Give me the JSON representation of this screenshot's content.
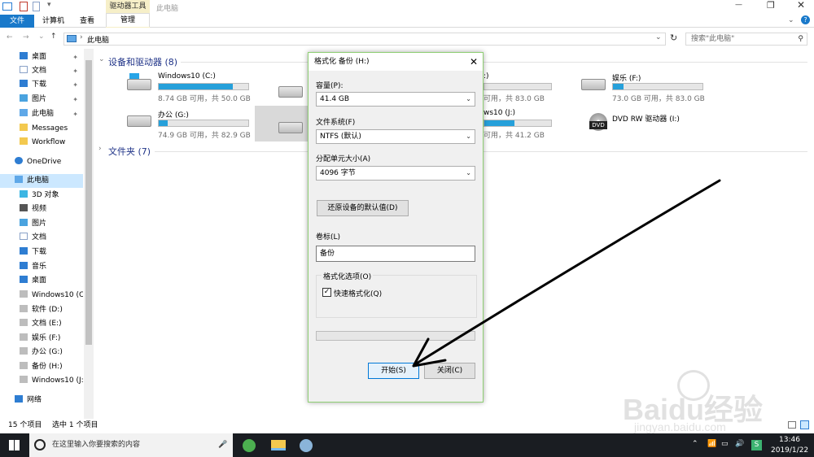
{
  "titlebar": {
    "title": "此电脑"
  },
  "ribbon": {
    "tabs": [
      "文件",
      "计算机",
      "查看"
    ],
    "context_header": "驱动器工具",
    "context_tab": "管理"
  },
  "address": {
    "crumb": "此电脑",
    "search_placeholder": "搜索\"此电脑\""
  },
  "sidebar": {
    "quick": [
      {
        "label": "桌面",
        "pinned": true
      },
      {
        "label": "文档",
        "pinned": true
      },
      {
        "label": "下载",
        "pinned": true
      },
      {
        "label": "图片",
        "pinned": true
      },
      {
        "label": "此电脑",
        "pinned": true
      },
      {
        "label": "Messages",
        "pinned": false
      },
      {
        "label": "Workflow",
        "pinned": false
      }
    ],
    "onedrive": "OneDrive",
    "thispc": "此电脑",
    "pc_items": [
      "3D 对象",
      "视频",
      "图片",
      "文档",
      "下载",
      "音乐",
      "桌面",
      "Windows10 (C:",
      "软件 (D:)",
      "文档 (E:)",
      "娱乐 (F:)",
      "办公 (G:)",
      "备份 (H:)",
      "Windows10 (J:)"
    ],
    "network": "网络"
  },
  "content": {
    "drives_group": "设备和驱动器 (8)",
    "folders_group": "文件夹 (7)",
    "drives": [
      {
        "name": "Windows10 (C:)",
        "cap": "8.74 GB 可用，共 50.0 GB",
        "used": 0.83
      },
      {
        "name": "办公 (G:)",
        "cap": "74.9 GB 可用，共 82.9 GB",
        "used": 0.1
      },
      {
        "name": "娱乐 (F:)",
        "cap": "73.0 GB 可用，共 83.0 GB",
        "used": 0.12
      },
      {
        "name": "DVD RW 驱动器 (I:)",
        "cap": "",
        "used": 0
      }
    ],
    "partial": [
      {
        "cap": "可用，共 83.0 GB",
        "used": 0.0
      },
      {
        "name": "ws10 (J:)",
        "cap": "可用，共 41.2 GB",
        "used": 0.45
      }
    ]
  },
  "status": {
    "count": "15 个项目",
    "selected": "选中 1 个项目"
  },
  "dialog": {
    "title": "格式化 备份 (H:)",
    "capacity_label": "容量(P):",
    "capacity": "41.4 GB",
    "fs_label": "文件系统(F)",
    "fs": "NTFS (默认)",
    "alloc_label": "分配单元大小(A)",
    "alloc": "4096 字节",
    "restore_btn": "还原设备的默认值(D)",
    "volume_label": "卷标(L)",
    "volume": "备份",
    "options_label": "格式化选项(O)",
    "quick_format": "快速格式化(Q)",
    "quick_checked": true,
    "start_btn": "开始(S)",
    "close_btn": "关闭(C)"
  },
  "taskbar": {
    "search": "在这里输入你要搜索的内容",
    "time": "13:46",
    "date": "2019/1/22"
  },
  "watermark": {
    "logo": "Baidu经验",
    "url": "jingyan.baidu.com"
  },
  "colors": {
    "accent": "#0078d7",
    "selection": "#cce8ff",
    "drive_fill": "#26a0da",
    "dialog_border": "#8fcf74"
  }
}
